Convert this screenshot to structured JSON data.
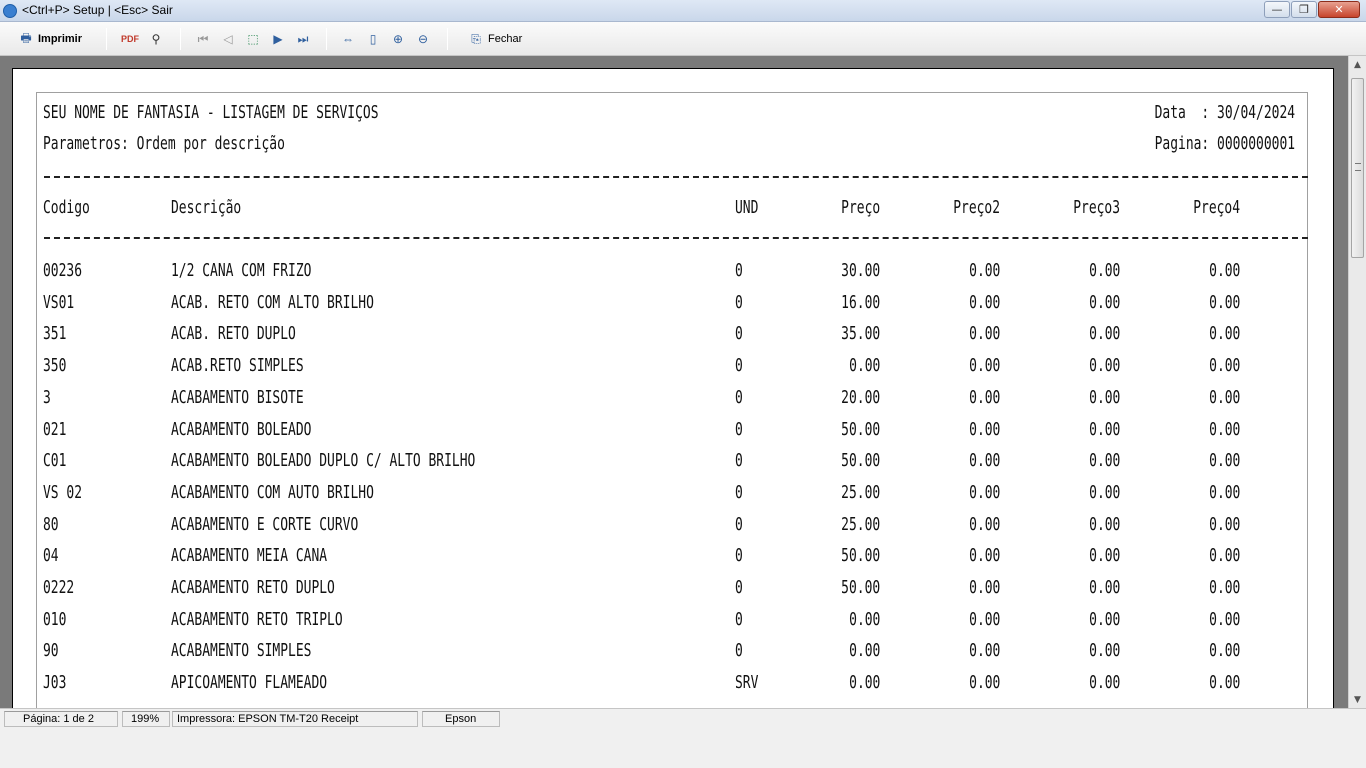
{
  "window": {
    "title": "<Ctrl+P> Setup | <Esc> Sair"
  },
  "toolbar": {
    "print_label": "Imprimir",
    "close_label": "Fechar"
  },
  "report": {
    "title": "SEU NOME DE FANTASIA - LISTAGEM DE SERVIÇOS",
    "params": "Parametros: Ordem por descrição",
    "date_label": "Data  : 30/04/2024",
    "page_label": "Pagina: 0000000001",
    "columns": [
      "Codigo",
      "Descrição",
      "UND",
      "Preço",
      "Preço2",
      "Preço3",
      "Preço4"
    ],
    "rows": [
      [
        "00236",
        "1/2 CANA COM FRIZO",
        "0",
        "30.00",
        "0.00",
        "0.00",
        "0.00"
      ],
      [
        "VS01",
        "ACAB. RETO COM ALTO BRILHO",
        "0",
        "16.00",
        "0.00",
        "0.00",
        "0.00"
      ],
      [
        "351",
        "ACAB. RETO DUPLO",
        "0",
        "35.00",
        "0.00",
        "0.00",
        "0.00"
      ],
      [
        "350",
        "ACAB.RETO SIMPLES",
        "0",
        "0.00",
        "0.00",
        "0.00",
        "0.00"
      ],
      [
        "3",
        "ACABAMENTO BISOTE",
        "0",
        "20.00",
        "0.00",
        "0.00",
        "0.00"
      ],
      [
        "021",
        "ACABAMENTO BOLEADO",
        "0",
        "50.00",
        "0.00",
        "0.00",
        "0.00"
      ],
      [
        "C01",
        "ACABAMENTO BOLEADO DUPLO C/ ALTO BRILHO",
        "0",
        "50.00",
        "0.00",
        "0.00",
        "0.00"
      ],
      [
        "VS 02",
        "ACABAMENTO COM AUTO BRILHO",
        "0",
        "25.00",
        "0.00",
        "0.00",
        "0.00"
      ],
      [
        "80",
        "ACABAMENTO E CORTE CURVO",
        "0",
        "25.00",
        "0.00",
        "0.00",
        "0.00"
      ],
      [
        "04",
        "ACABAMENTO MEIA CANA",
        "0",
        "50.00",
        "0.00",
        "0.00",
        "0.00"
      ],
      [
        "0222",
        "ACABAMENTO RETO DUPLO",
        "0",
        "50.00",
        "0.00",
        "0.00",
        "0.00"
      ],
      [
        "010",
        "ACABAMENTO RETO TRIPLO",
        "0",
        "0.00",
        "0.00",
        "0.00",
        "0.00"
      ],
      [
        "90",
        "ACABAMENTO SIMPLES",
        "0",
        "0.00",
        "0.00",
        "0.00",
        "0.00"
      ],
      [
        "J03",
        "APICOAMENTO FLAMEADO",
        "SRV",
        "0.00",
        "0.00",
        "0.00",
        "0.00"
      ]
    ]
  },
  "status": {
    "page": "Página: 1 de 2",
    "zoom": "199%",
    "printer": "Impressora: EPSON TM-T20 Receipt",
    "driver": "Epson"
  }
}
